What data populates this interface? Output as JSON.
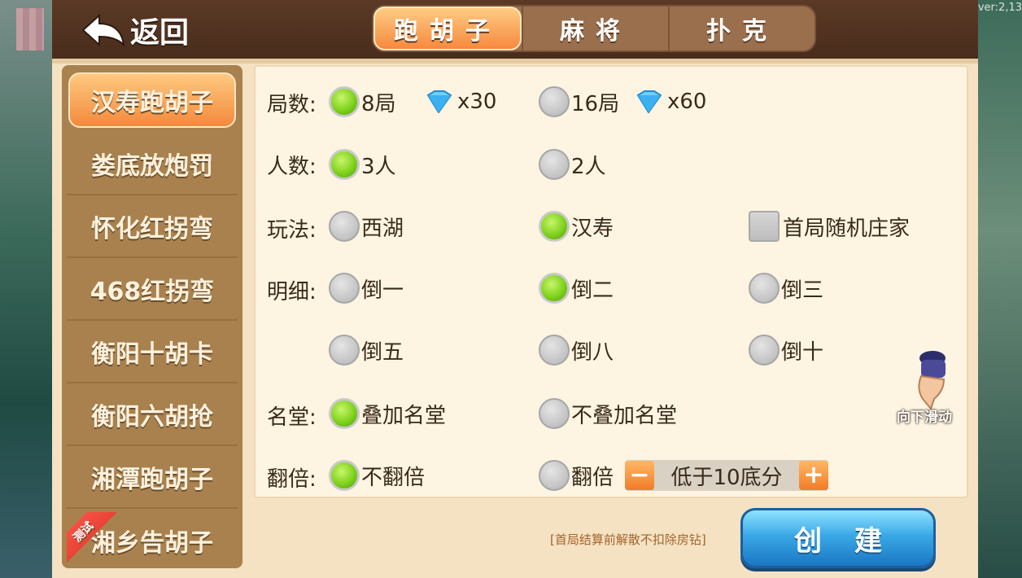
{
  "version": "ver:2,13",
  "back": {
    "label": "返回"
  },
  "tabs": [
    {
      "label": "跑胡子",
      "active": true
    },
    {
      "label": "麻将",
      "active": false
    },
    {
      "label": "扑克",
      "active": false
    }
  ],
  "sidebar": {
    "items": [
      {
        "label": "汉寿跑胡子",
        "active": true
      },
      {
        "label": "娄底放炮罚",
        "active": false
      },
      {
        "label": "怀化红拐弯",
        "active": false
      },
      {
        "label": "468红拐弯",
        "active": false
      },
      {
        "label": "衡阳十胡卡",
        "active": false
      },
      {
        "label": "衡阳六胡抢",
        "active": false
      },
      {
        "label": "湘潭跑胡子",
        "active": false
      },
      {
        "label": "湘乡告胡子",
        "active": false,
        "badge": "测试"
      }
    ]
  },
  "options": {
    "rounds": {
      "label": "局数:",
      "choices": [
        {
          "text": "8局",
          "cost": "x30",
          "selected": true
        },
        {
          "text": "16局",
          "cost": "x60",
          "selected": false
        }
      ]
    },
    "players": {
      "label": "人数:",
      "choices": [
        {
          "text": "3人",
          "selected": true
        },
        {
          "text": "2人",
          "selected": false
        }
      ]
    },
    "play": {
      "label": "玩法:",
      "choices": [
        {
          "text": "西湖",
          "selected": false
        },
        {
          "text": "汉寿",
          "selected": true
        }
      ],
      "checkbox": {
        "text": "首局随机庄家",
        "checked": false
      }
    },
    "details": {
      "label": "明细:",
      "choices": [
        {
          "text": "倒一",
          "selected": false
        },
        {
          "text": "倒二",
          "selected": true
        },
        {
          "text": "倒三",
          "selected": false
        },
        {
          "text": "倒五",
          "selected": false
        },
        {
          "text": "倒八",
          "selected": false
        },
        {
          "text": "倒十",
          "selected": false
        }
      ]
    },
    "hall": {
      "label": "名堂",
      "choices": [
        {
          "text": "叠加名堂",
          "selected": true
        },
        {
          "text": "不叠加名堂",
          "selected": false
        }
      ]
    },
    "double": {
      "label": "翻倍:",
      "choices": [
        {
          "text": "不翻倍",
          "selected": true
        },
        {
          "text": "翻倍",
          "selected": false
        }
      ],
      "stepper": {
        "minus": "−",
        "value": "低于10底分",
        "plus": "+"
      }
    }
  },
  "notice": "[首局结算前解散不扣除房钻]",
  "create": {
    "label": "创建"
  },
  "swipe_hint": "向下滑动",
  "colors": {
    "accent_orange": "#f28a3d",
    "selected_green": "#7fd21d",
    "create_blue": "#3aa8e6",
    "panel_bg": "#fdf4e2",
    "sidebar_bg": "#a9814e"
  }
}
